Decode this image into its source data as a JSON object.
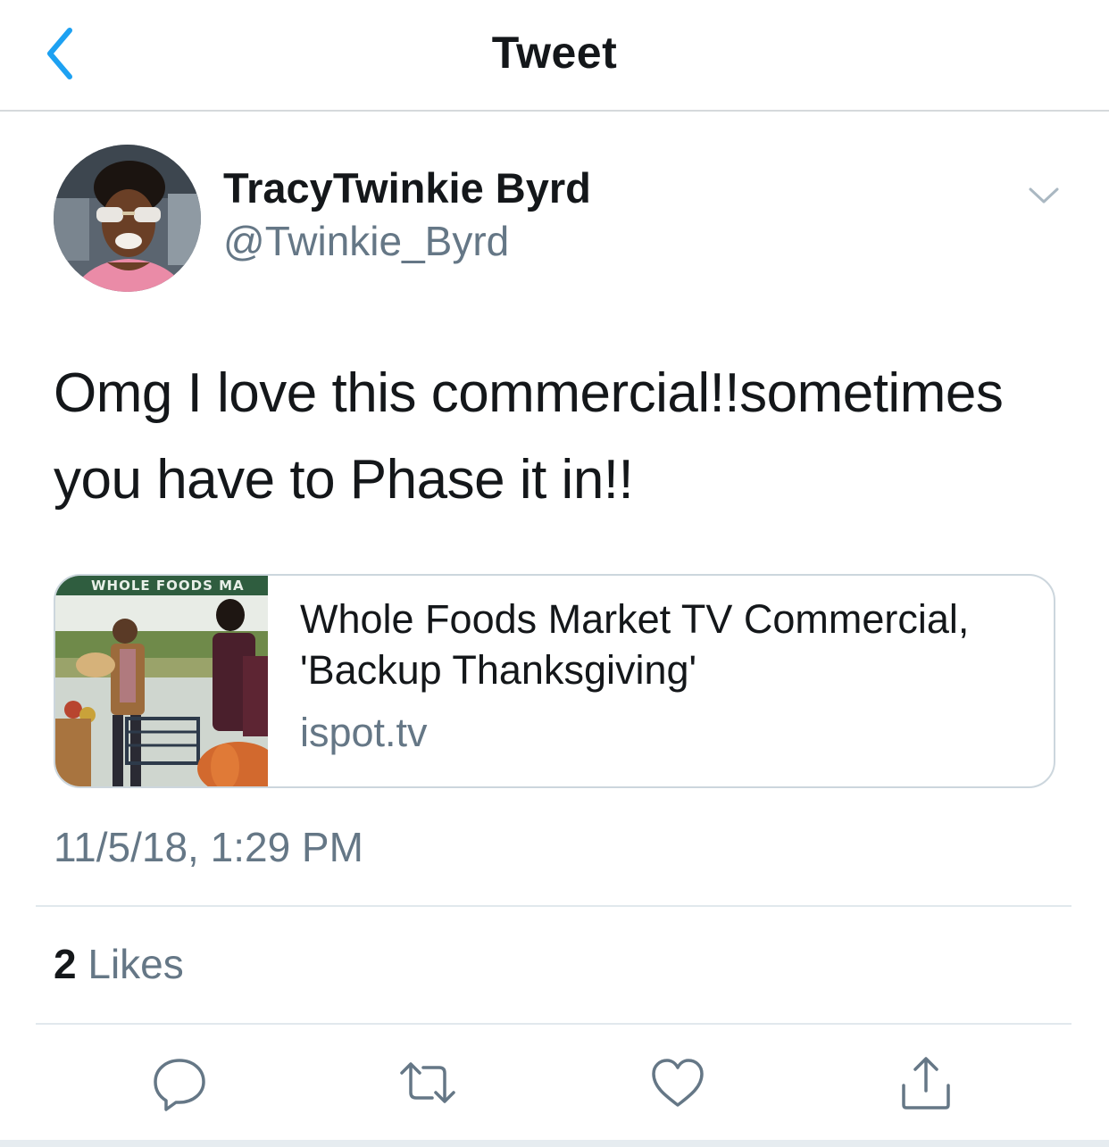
{
  "nav": {
    "title": "Tweet",
    "back_icon": "chevron-left-icon"
  },
  "tweet": {
    "author_name": "TracyTwinkie Byrd",
    "author_handle": "@Twinkie_Byrd",
    "text_line1": "Omg I love this commercial!!sometimes",
    "text_line2": "you have to Phase it in!!",
    "timestamp": "11/5/18, 1:29 PM",
    "likes_count": "2",
    "likes_label": "Likes"
  },
  "card": {
    "title_line1": "Whole Foods Market TV Commercial,",
    "title_line2": "'Backup Thanksgiving'",
    "domain": "ispot.tv",
    "thumbnail_sign_text": "WHOLE FOODS MA"
  },
  "actions": [
    "reply-icon",
    "retweet-icon",
    "like-icon",
    "share-icon"
  ],
  "colors": {
    "accent": "#1da1f2",
    "text_primary": "#14171a",
    "text_secondary": "#657786",
    "divider": "#e1e8ed",
    "card_border": "#ccd6dd"
  }
}
